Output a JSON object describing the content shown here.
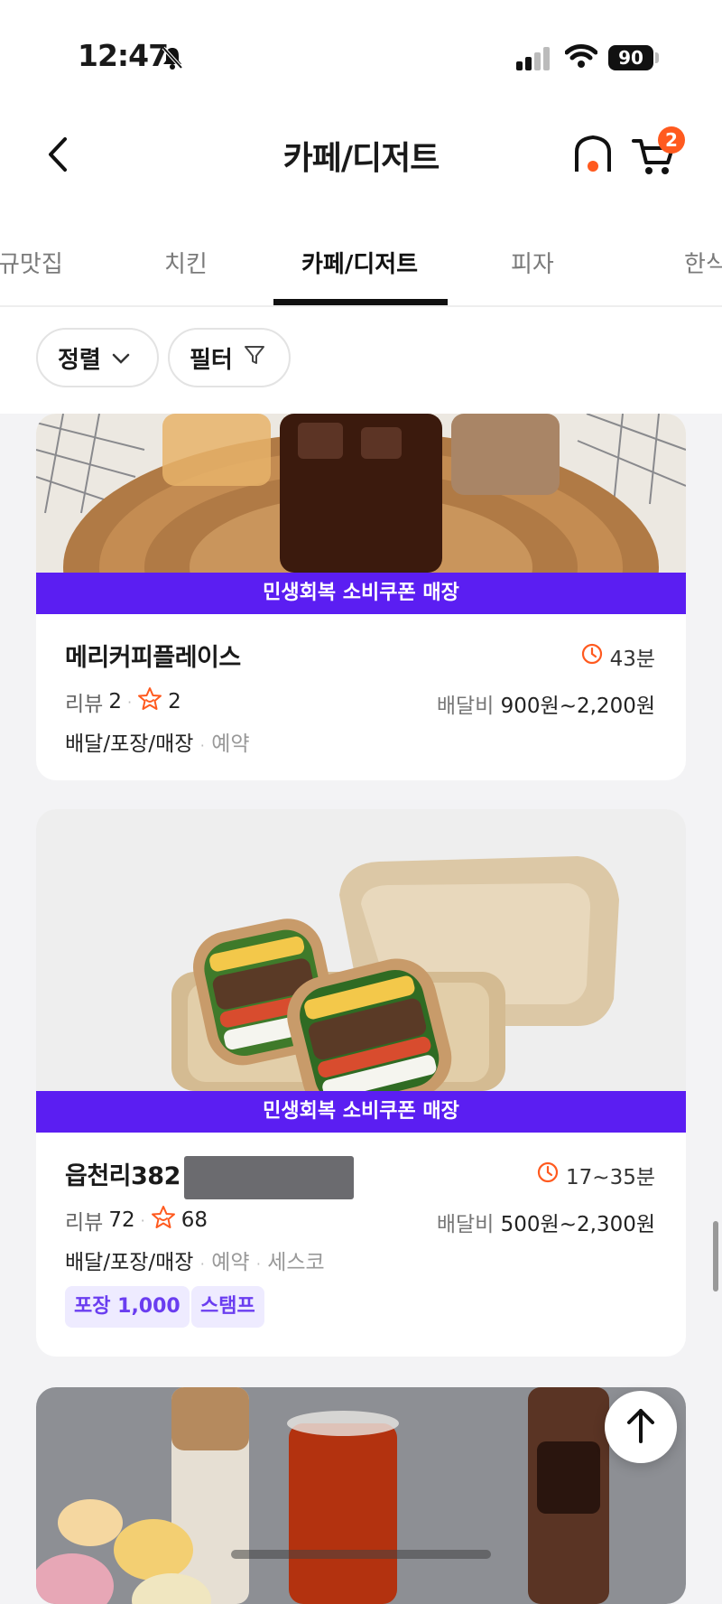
{
  "status_bar": {
    "time": "12:47",
    "battery": "90"
  },
  "header": {
    "title": "카페/디저트",
    "cart_count": "2"
  },
  "tabs": [
    {
      "label": "규맛집"
    },
    {
      "label": "치킨"
    },
    {
      "label": "카페/디저트"
    },
    {
      "label": "피자"
    },
    {
      "label": "한식"
    }
  ],
  "filters": {
    "sort_label": "정렬",
    "filter_label": "필터"
  },
  "stores": [
    {
      "banner": "민생회복 소비쿠폰 매장",
      "name": "메리커피플레이스",
      "eta": "43분",
      "review_label": "리뷰",
      "review_count": "2",
      "rating_count": "2",
      "fee_label": "배달비",
      "fee": "900원~2,200원",
      "services": "배달/포장/매장",
      "extra1": "예약"
    },
    {
      "banner": "민생회복 소비쿠폰 매장",
      "name": "읍천리382",
      "eta": "17~35분",
      "review_label": "리뷰",
      "review_count": "72",
      "rating_count": "68",
      "fee_label": "배달비",
      "fee": "500원~2,300원",
      "services": "배달/포장/매장",
      "extra1": "예약",
      "extra2": "세스코",
      "tags": [
        "포장 1,000",
        "스탬프"
      ]
    }
  ],
  "icons": {
    "back": "chevron-left-icon",
    "home": "home-icon",
    "cart": "cart-icon",
    "sort": "chevron-down-icon",
    "filter": "funnel-icon",
    "clock": "clock-icon",
    "rating": "flower-star-icon",
    "scroll_top": "arrow-up-icon"
  },
  "colors": {
    "banner": "#5b1ef2",
    "accent": "#ff5a1f",
    "tag_bg": "#eeebff",
    "tag_text": "#6a3df0"
  }
}
